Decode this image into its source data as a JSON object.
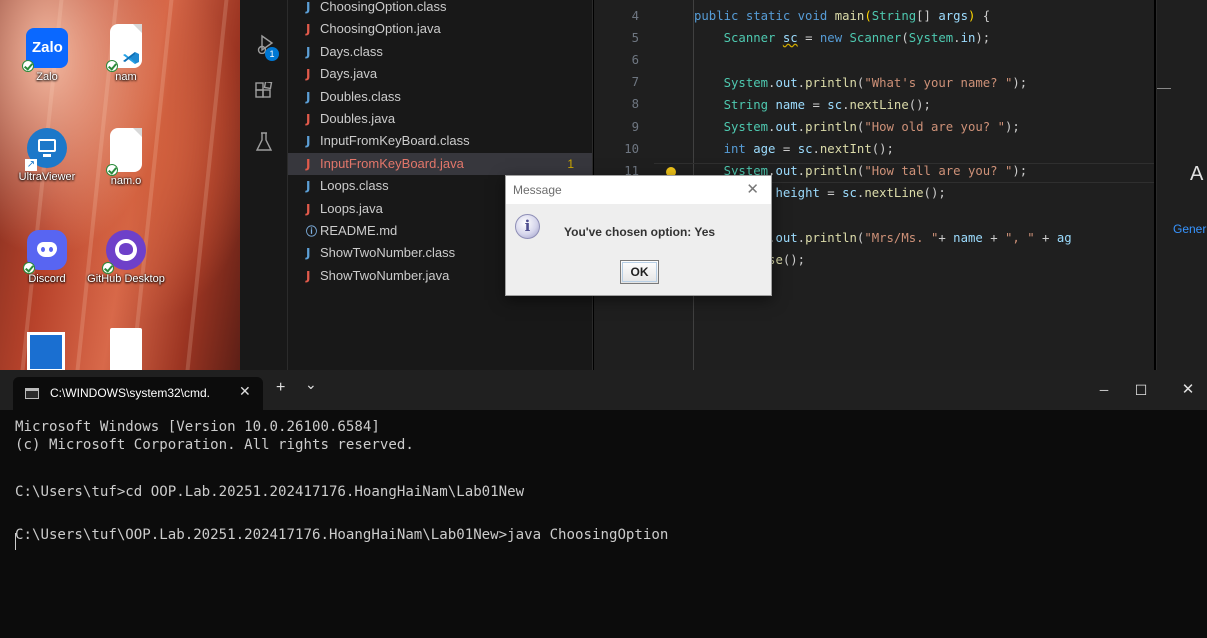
{
  "desktop": {
    "icons": [
      {
        "id": "zalo",
        "label": "Zalo",
        "tile_text": "Zalo"
      },
      {
        "id": "nam",
        "label": "nam"
      },
      {
        "id": "ultraviewer",
        "label": "UltraViewer"
      },
      {
        "id": "nam-o",
        "label": "nam.o"
      },
      {
        "id": "discord",
        "label": "Discord"
      },
      {
        "id": "github",
        "label": "GitHub Desktop"
      }
    ]
  },
  "vscode": {
    "activity_badge": "1",
    "explorer_files": [
      {
        "name": "ChoosingOption.class",
        "kind": "class"
      },
      {
        "name": "ChoosingOption.java",
        "kind": "java"
      },
      {
        "name": "Days.class",
        "kind": "class"
      },
      {
        "name": "Days.java",
        "kind": "java"
      },
      {
        "name": "Doubles.class",
        "kind": "class"
      },
      {
        "name": "Doubles.java",
        "kind": "java"
      },
      {
        "name": "InputFromKeyBoard.class",
        "kind": "class"
      },
      {
        "name": "InputFromKeyBoard.java",
        "kind": "java",
        "active": true,
        "problems": "1"
      },
      {
        "name": "Loops.class",
        "kind": "class"
      },
      {
        "name": "Loops.java",
        "kind": "java"
      },
      {
        "name": "README.md",
        "kind": "info"
      },
      {
        "name": "ShowTwoNumber.class",
        "kind": "class"
      },
      {
        "name": "ShowTwoNumber.java",
        "kind": "java"
      }
    ],
    "line_numbers": [
      "4",
      "5",
      "6",
      "7",
      "8",
      "9",
      "10",
      "11",
      "12"
    ],
    "right_panel_letter": "A",
    "right_panel_text": "Gener"
  },
  "dialog": {
    "title": "Message",
    "close": "✕",
    "info_glyph": "i",
    "message": "You've chosen option: Yes",
    "ok_label": "OK"
  },
  "terminal": {
    "tab_title": "C:\\WINDOWS\\system32\\cmd.",
    "tab_close": "✕",
    "new_tab": "+",
    "dropdown": "⌄",
    "minimize": "─",
    "maximize": "☐",
    "close": "✕",
    "lines": [
      "Microsoft Windows [Version 10.0.26100.6584]",
      "(c) Microsoft Corporation. All rights reserved.",
      "",
      "C:\\Users\\tuf>cd OOP.Lab.20251.202417176.HoangHaiNam\\Lab01New",
      "",
      "C:\\Users\\tuf\\OOP.Lab.20251.202417176.HoangHaiNam\\Lab01New>java ChoosingOption"
    ]
  },
  "colors": {
    "terminal_bg": "#0c0c0c",
    "editor_bg": "#1f1f1f",
    "dialog_bg": "#eeeeee",
    "active_file": "#e2766a"
  }
}
